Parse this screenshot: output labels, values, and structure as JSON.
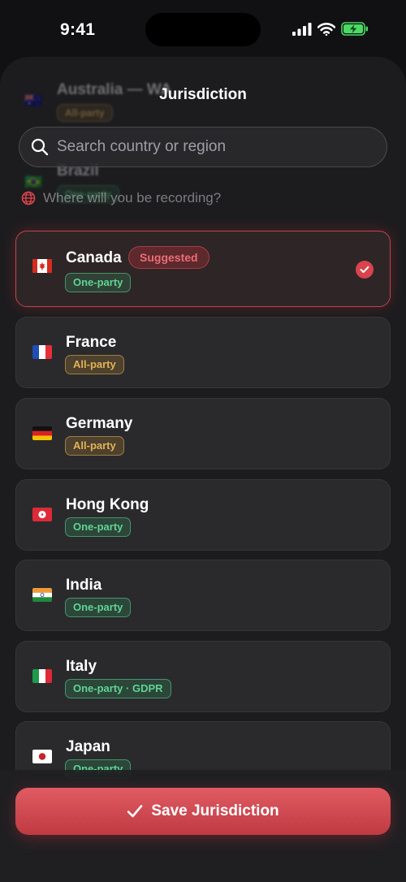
{
  "status_bar": {
    "time": "9:41"
  },
  "header": {
    "title": "Jurisdiction"
  },
  "search": {
    "placeholder": "Search country or region",
    "value": ""
  },
  "prompt": {
    "text": "Where will you be recording?"
  },
  "ghost_rows": [
    {
      "flag": "🇦🇺",
      "name": "Australia — WA",
      "badge": "All-party",
      "tone": "amber"
    },
    {
      "flag": "🇧🇷",
      "name": "Brazil",
      "badge": "One-party",
      "tone": "green"
    }
  ],
  "countries": [
    {
      "flag": "canada",
      "name": "Canada",
      "badge": "One-party",
      "tone": "green",
      "suggested": "Suggested",
      "selected": true
    },
    {
      "flag": "france",
      "name": "France",
      "badge": "All-party",
      "tone": "amber"
    },
    {
      "flag": "germany",
      "name": "Germany",
      "badge": "All-party",
      "tone": "amber"
    },
    {
      "flag": "hongkong",
      "name": "Hong Kong",
      "badge": "One-party",
      "tone": "green"
    },
    {
      "flag": "india",
      "name": "India",
      "badge": "One-party",
      "tone": "green"
    },
    {
      "flag": "italy",
      "name": "Italy",
      "badge": "One-party · GDPR",
      "tone": "green"
    },
    {
      "flag": "japan",
      "name": "Japan",
      "badge": "One-party",
      "tone": "green"
    }
  ],
  "footer": {
    "save_label": "Save Jurisdiction"
  },
  "colors": {
    "accent": "#d9434d",
    "one_party": "#5fd494",
    "all_party": "#e2b257",
    "background": "#1c1c1e"
  }
}
